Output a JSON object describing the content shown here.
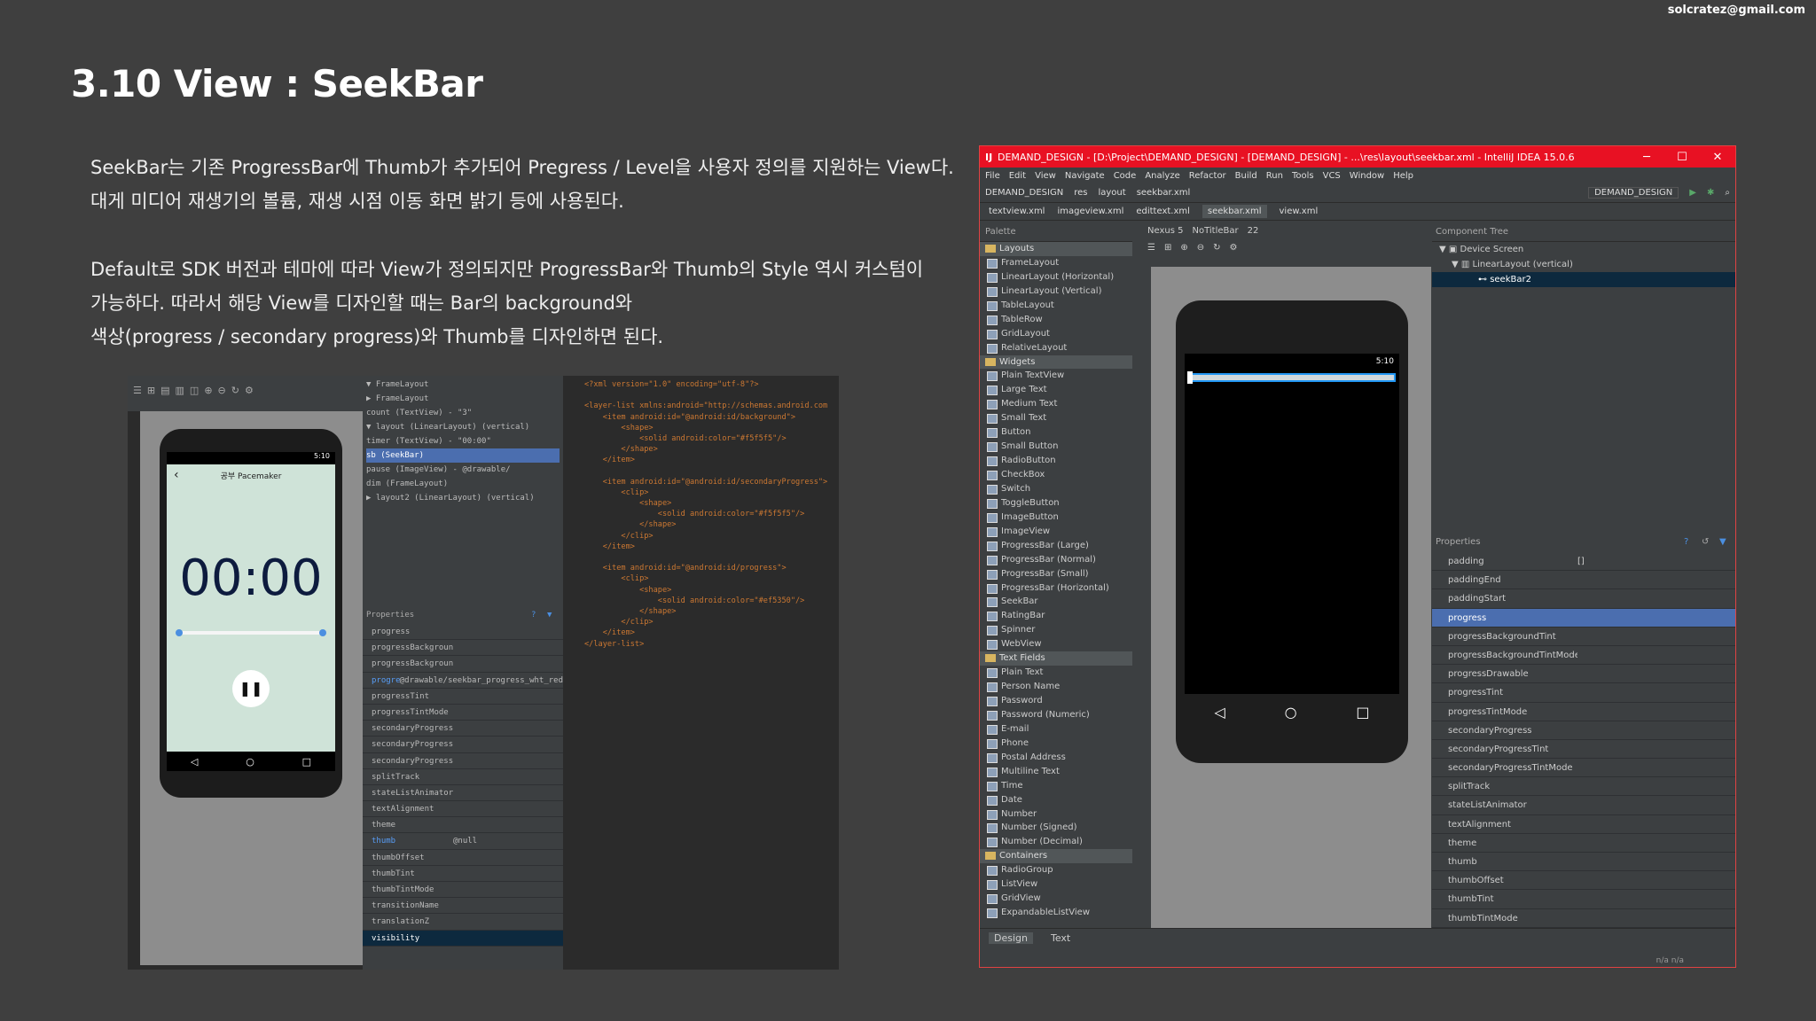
{
  "email": "solcratez@gmail.com",
  "title": "3.10 View : SeekBar",
  "paragraphs": [
    "SeekBar는 기존 ProgressBar에 Thumb가 추가되어 Pregress / Level을 사용자 정의를 지원하는 View다.",
    "대게 미디어 재생기의 볼륨, 재생 시점 이동 화면 밝기 등에 사용된다.",
    "Default로 SDK 버전과 테마에 따라 View가 정의되지만 ProgressBar와 Thumb의 Style 역시 커스텀이",
    "가능하다. 따라서 해당 View를 디자인할 때는 Bar의 background와",
    "색상(progress / secondary progress)와 Thumb를 디자인하면 된다."
  ],
  "left_shot": {
    "app_title": "공부 Pacemaker",
    "time": "00:00",
    "status_time": "5:10",
    "tree": [
      "▼ FrameLayout",
      "  ▶ FrameLayout",
      "    count (TextView) - \"3\"",
      "  ▼ layout (LinearLayout) (vertical)",
      "      timer (TextView) - \"00:00\"",
      "      sb (SeekBar)",
      "      pause (ImageView) - @drawable/",
      "    dim (FrameLayout)",
      "  ▶ layout2 (LinearLayout) (vertical)"
    ],
    "props_label": "Properties",
    "props": [
      [
        "progress",
        ""
      ],
      [
        "progressBackgroundTi",
        ""
      ],
      [
        "progressBackgroundTi",
        ""
      ],
      [
        "progressDrawable",
        "@drawable/seekbar_progress_wht_red"
      ],
      [
        "progressTint",
        ""
      ],
      [
        "progressTintMode",
        ""
      ],
      [
        "secondaryProgress",
        ""
      ],
      [
        "secondaryProgressTi",
        ""
      ],
      [
        "secondaryProgressTi",
        ""
      ],
      [
        "splitTrack",
        ""
      ],
      [
        "stateListAnimator",
        ""
      ],
      [
        "textAlignment",
        ""
      ],
      [
        "theme",
        ""
      ],
      [
        "thumb",
        "@null"
      ],
      [
        "thumbOffset",
        ""
      ],
      [
        "thumbTint",
        ""
      ],
      [
        "thumbTintMode",
        ""
      ],
      [
        "transitionName",
        ""
      ],
      [
        "translationZ",
        ""
      ],
      [
        "visibility",
        ""
      ]
    ],
    "code": [
      "<?xml version=\"1.0\" encoding=\"utf-8\"?>",
      "",
      "<layer-list xmlns:android=\"http://schemas.android.com",
      "    <item android:id=\"@android:id/background\">",
      "        <shape>",
      "            <solid android:color=\"#f5f5f5\"/>",
      "        </shape>",
      "    </item>",
      "",
      "    <item android:id=\"@android:id/secondaryProgress\">",
      "        <clip>",
      "            <shape>",
      "                <solid android:color=\"#f5f5f5\"/>",
      "            </shape>",
      "        </clip>",
      "    </item>",
      "",
      "    <item android:id=\"@android:id/progress\">",
      "        <clip>",
      "            <shape>",
      "                <solid android:color=\"#ef5350\"/>",
      "            </shape>",
      "        </clip>",
      "    </item>",
      "</layer-list>"
    ]
  },
  "ide": {
    "window_title": "DEMAND_DESIGN - [D:\\Project\\DEMAND_DESIGN] - [DEMAND_DESIGN] - ...\\res\\layout\\seekbar.xml - IntelliJ IDEA 15.0.6",
    "menu": [
      "File",
      "Edit",
      "View",
      "Navigate",
      "Code",
      "Analyze",
      "Refactor",
      "Build",
      "Run",
      "Tools",
      "VCS",
      "Window",
      "Help"
    ],
    "nav": [
      "DEMAND_DESIGN",
      "res",
      "layout",
      "seekbar.xml"
    ],
    "run_config": "DEMAND_DESIGN",
    "tabs": [
      "textview.xml",
      "imageview.xml",
      "edittext.xml",
      "seekbar.xml",
      "view.xml"
    ],
    "active_tab": 3,
    "palette_label": "Palette",
    "palette": [
      {
        "cat": "Layouts",
        "items": [
          "FrameLayout",
          "LinearLayout (Horizontal)",
          "LinearLayout (Vertical)",
          "TableLayout",
          "TableRow",
          "GridLayout",
          "RelativeLayout"
        ]
      },
      {
        "cat": "Widgets",
        "items": [
          "Plain TextView",
          "Large Text",
          "Medium Text",
          "Small Text",
          "Button",
          "Small Button",
          "RadioButton",
          "CheckBox",
          "Switch",
          "ToggleButton",
          "ImageButton",
          "ImageView",
          "ProgressBar (Large)",
          "ProgressBar (Normal)",
          "ProgressBar (Small)",
          "ProgressBar (Horizontal)",
          "SeekBar",
          "RatingBar",
          "Spinner",
          "WebView"
        ]
      },
      {
        "cat": "Text Fields",
        "items": [
          "Plain Text",
          "Person Name",
          "Password",
          "Password (Numeric)",
          "E-mail",
          "Phone",
          "Postal Address",
          "Multiline Text",
          "Time",
          "Date",
          "Number",
          "Number (Signed)",
          "Number (Decimal)"
        ]
      },
      {
        "cat": "Containers",
        "items": [
          "RadioGroup",
          "ListView",
          "GridView",
          "ExpandableListView"
        ]
      }
    ],
    "device": "Nexus 5",
    "theme": "NoTitleBar",
    "api": "22",
    "status_time": "5:10",
    "component_tree_label": "Component Tree",
    "component_tree": [
      "Device Screen",
      "LinearLayout (vertical)",
      "seekBar2"
    ],
    "properties_label": "Properties",
    "props": [
      [
        "padding",
        "[]"
      ],
      [
        "paddingEnd",
        ""
      ],
      [
        "paddingStart",
        ""
      ],
      [
        "progress",
        ""
      ],
      [
        "progressBackgroundTint",
        ""
      ],
      [
        "progressBackgroundTintMode",
        ""
      ],
      [
        "progressDrawable",
        ""
      ],
      [
        "progressTint",
        ""
      ],
      [
        "progressTintMode",
        ""
      ],
      [
        "secondaryProgress",
        ""
      ],
      [
        "secondaryProgressTint",
        ""
      ],
      [
        "secondaryProgressTintMode",
        ""
      ],
      [
        "splitTrack",
        ""
      ],
      [
        "stateListAnimator",
        ""
      ],
      [
        "textAlignment",
        ""
      ],
      [
        "theme",
        ""
      ],
      [
        "thumb",
        ""
      ],
      [
        "thumbOffset",
        ""
      ],
      [
        "thumbTint",
        ""
      ],
      [
        "thumbTintMode",
        ""
      ]
    ],
    "selected_prop": 3,
    "bottom_tabs": [
      "Design",
      "Text"
    ],
    "status_right": "n/a   n/a"
  }
}
